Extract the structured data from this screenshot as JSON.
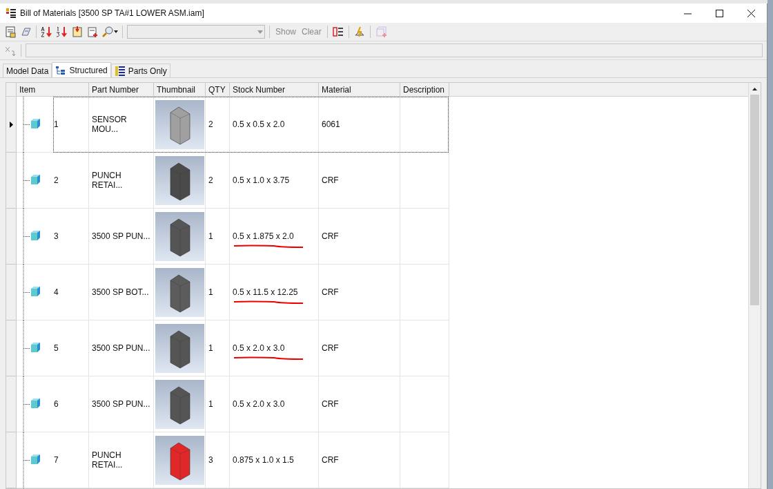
{
  "window": {
    "title": "Bill of Materials [3500 SP TA#1 LOWER ASM.iam]"
  },
  "toolbar": {
    "filter_dropdown": {
      "disabled": true
    },
    "show_button": {
      "label": "Show",
      "disabled": true
    },
    "clear_button": {
      "label": "Clear",
      "disabled": true
    }
  },
  "tabs": [
    {
      "label": "Model Data",
      "selected": false,
      "kind": "plain"
    },
    {
      "label": "Structured",
      "selected": true,
      "kind": "tree"
    },
    {
      "label": "Parts Only",
      "selected": false,
      "kind": "list"
    }
  ],
  "table": {
    "columns": [
      "Item",
      "Part Number",
      "Thumbnail",
      "QTY",
      "Stock Number",
      "Material",
      "Description"
    ],
    "rows": [
      {
        "item": "1",
        "part_number": "SENSOR MOU...",
        "qty": "2",
        "stock_number": "0.5 x 0.5 x 2.0",
        "material": "6061",
        "selected": true,
        "underlined": false,
        "color": "#a0a0a0"
      },
      {
        "item": "2",
        "part_number": "PUNCH RETAI...",
        "qty": "2",
        "stock_number": "0.5 x 1.0 x 3.75",
        "material": "CRF",
        "selected": false,
        "underlined": false,
        "color": "#4a4a4a"
      },
      {
        "item": "3",
        "part_number": "3500 SP PUN...",
        "qty": "1",
        "stock_number": "0.5 x 1.875 x 2.0",
        "material": "CRF",
        "selected": false,
        "underlined": true,
        "color": "#555555"
      },
      {
        "item": "4",
        "part_number": "3500 SP BOT...",
        "qty": "1",
        "stock_number": "0.5 x 11.5 x 12.25",
        "material": "CRF",
        "selected": false,
        "underlined": true,
        "color": "#5c5c5c"
      },
      {
        "item": "5",
        "part_number": "3500 SP PUN...",
        "qty": "1",
        "stock_number": "0.5 x 2.0 x 3.0",
        "material": "CRF",
        "selected": false,
        "underlined": true,
        "color": "#555555"
      },
      {
        "item": "6",
        "part_number": "3500 SP PUN...",
        "qty": "1",
        "stock_number": "0.5 x 2.0 x 3.0",
        "material": "CRF",
        "selected": false,
        "underlined": false,
        "color": "#555555"
      },
      {
        "item": "7",
        "part_number": "PUNCH RETAI...",
        "qty": "3",
        "stock_number": "0.875 x 1.0 x 1.5",
        "material": "CRF",
        "selected": false,
        "underlined": false,
        "color": "#e02828"
      }
    ]
  }
}
